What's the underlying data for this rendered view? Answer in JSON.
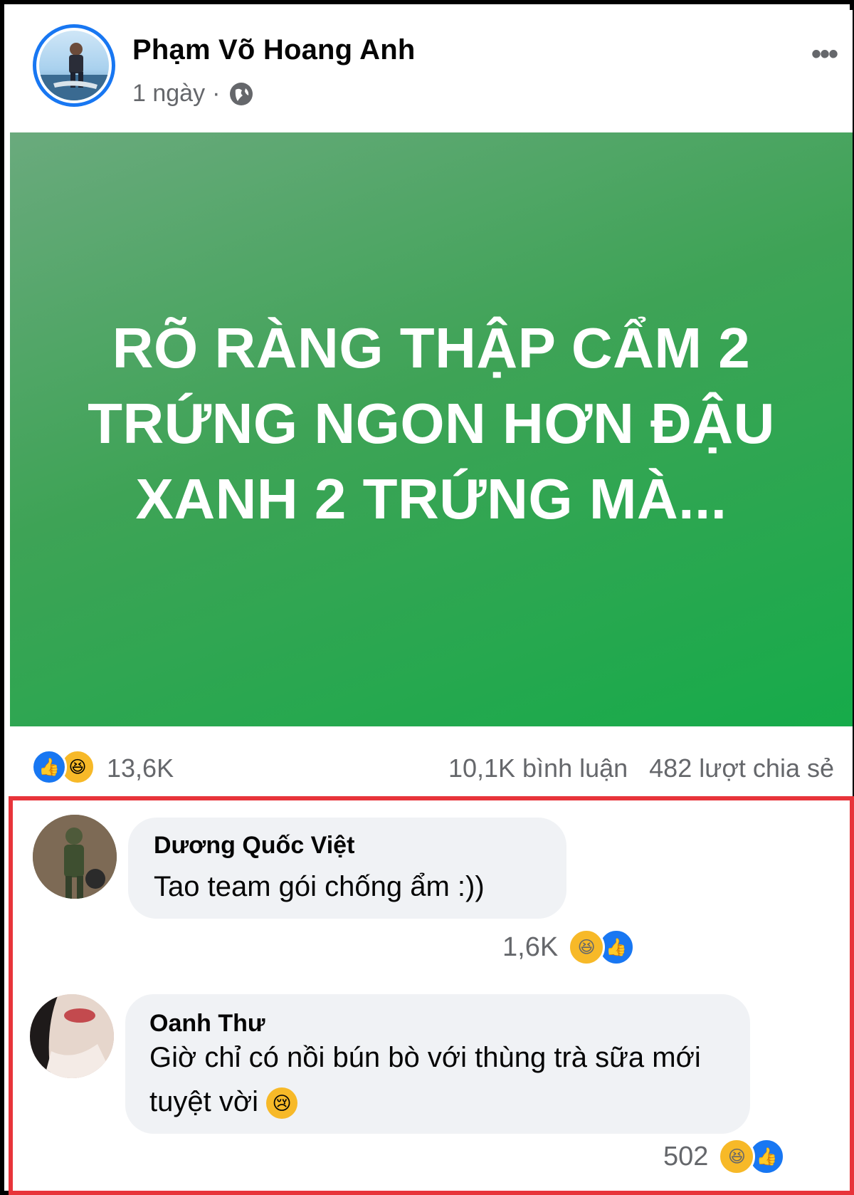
{
  "post": {
    "author": "Phạm Võ Hoang Anh",
    "time": "1 ngày",
    "separator": "·",
    "privacy_icon": "globe-icon",
    "more_icon": "•••",
    "text": "RÕ RÀNG THẬP CẨM 2\nTRỨNG NGON HƠN ĐẬU\nXANH 2 TRỨNG MÀ...",
    "background_colors": [
      "#6aaa7d",
      "#16ab4a"
    ]
  },
  "stats": {
    "reactions_count": "13,6K",
    "comments": "10,1K bình luận",
    "shares": "482 lượt chia sẻ",
    "reaction_icons": [
      "like-icon",
      "haha-icon"
    ]
  },
  "comments": [
    {
      "name": "Dương Quốc Việt",
      "text": "Tao team gói chống ẩm :))",
      "reactions": "1,6K"
    },
    {
      "name": "Oanh Thư",
      "text": "Giờ chỉ có nồi bún bò với thùng trà sữa mới tuyệt vời",
      "emoji": "😢",
      "reactions": "502"
    }
  ],
  "colors": {
    "accent": "#1877f2",
    "highlight_border": "#e8343a",
    "haha": "#f7b928"
  }
}
